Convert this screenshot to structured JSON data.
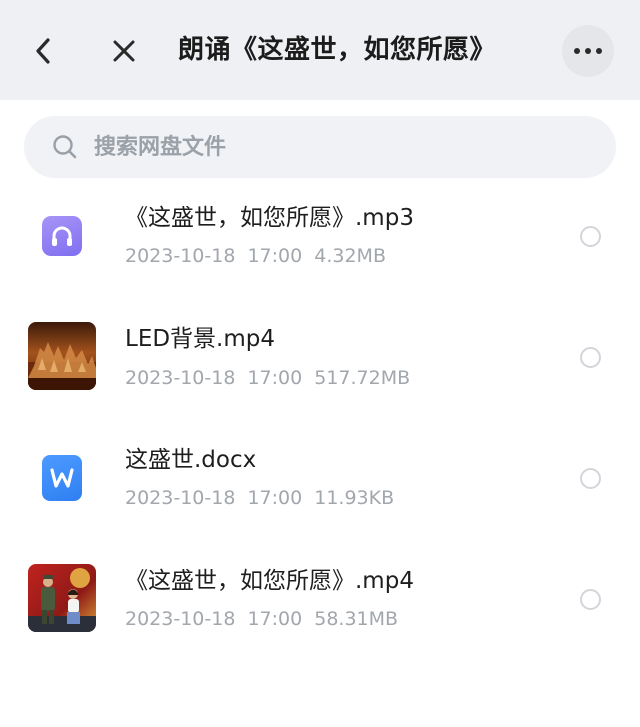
{
  "header": {
    "title": "朗诵《这盛世，如您所愿》",
    "back_icon": "chevron-left-icon",
    "close_icon": "close-icon",
    "more_icon": "more-dots-icon"
  },
  "search": {
    "placeholder": "搜索网盘文件",
    "value": ""
  },
  "files": [
    {
      "name": "《这盛世，如您所愿》.mp3",
      "meta": "2023-10-18  17:00  4.32MB",
      "icon": "audio-file-icon",
      "color": "#8f7ff3"
    },
    {
      "name": "LED背景.mp4",
      "meta": "2023-10-18  17:00  517.72MB",
      "icon": "video-thumbnail",
      "color": "#b8642c"
    },
    {
      "name": "这盛世.docx",
      "meta": "2023-10-18  17:00  11.93KB",
      "icon": "word-file-icon",
      "color": "#3a8cf7"
    },
    {
      "name": "《这盛世，如您所愿》.mp4",
      "meta": "2023-10-18  17:00  58.31MB",
      "icon": "video-thumbnail",
      "color": "#b8272a"
    }
  ]
}
